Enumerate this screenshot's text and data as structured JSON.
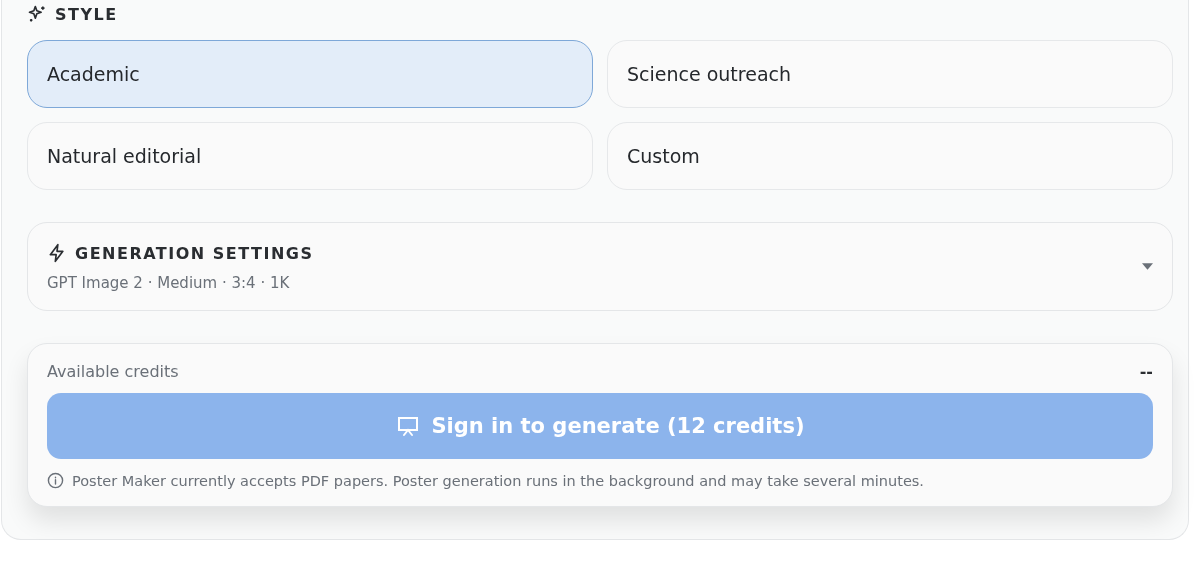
{
  "style_section": {
    "heading": "STYLE",
    "options": [
      {
        "label": "Academic",
        "selected": true
      },
      {
        "label": "Science outreach",
        "selected": false
      },
      {
        "label": "Natural editorial",
        "selected": false
      },
      {
        "label": "Custom",
        "selected": false
      }
    ]
  },
  "generation_settings": {
    "heading": "GENERATION SETTINGS",
    "summary": "GPT Image 2 · Medium · 3:4 · 1K",
    "expanded": false
  },
  "credits": {
    "label": "Available credits",
    "value": "--"
  },
  "generate_button": {
    "label": "Sign in to generate (12 credits)",
    "disabled": true
  },
  "note": "Poster Maker currently accepts PDF papers. Poster generation runs in the background and may take several minutes."
}
